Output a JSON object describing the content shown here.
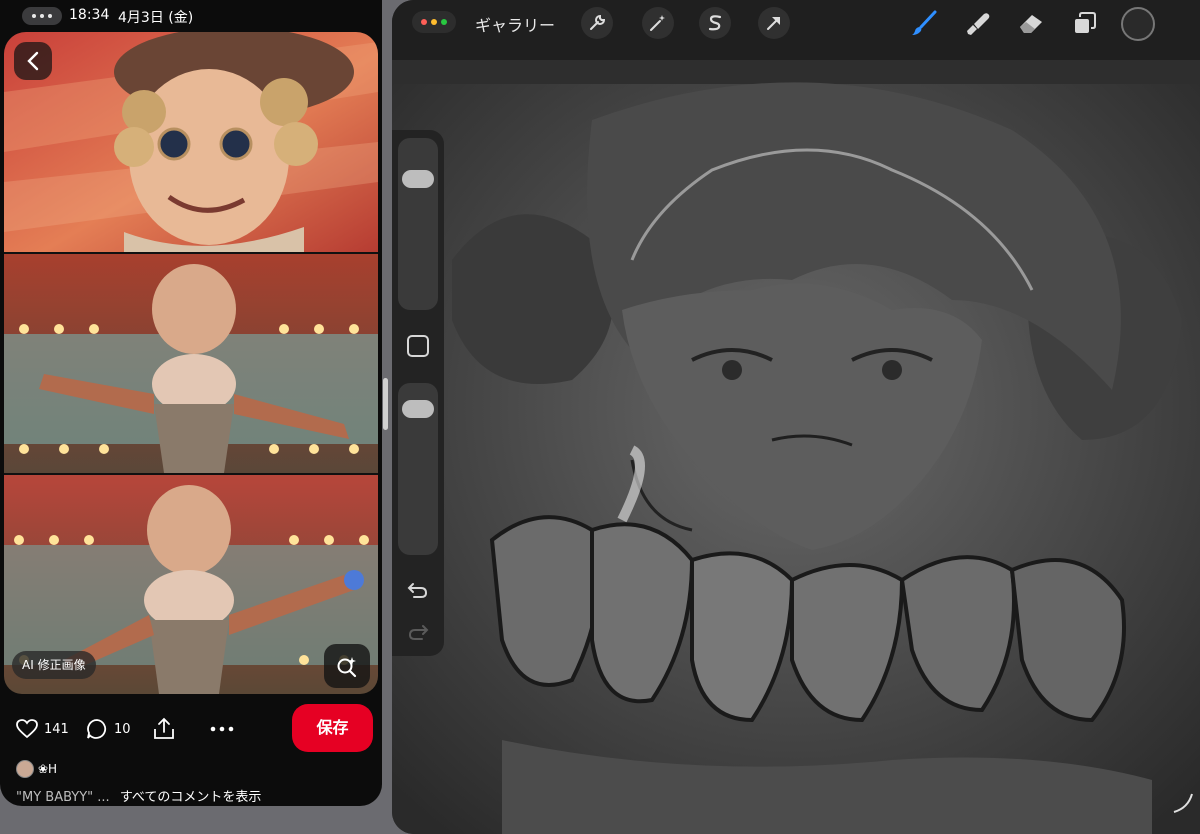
{
  "status": {
    "time": "18:34",
    "date": "4月3日 (金)"
  },
  "left": {
    "ai_badge": "AI 修正画像",
    "likes": "141",
    "comments": "10",
    "save_label": "保存",
    "author": "❀H",
    "caption_quote": "\"MY BABYY\" ...",
    "caption_comments": "すべてのコメントを表示"
  },
  "right": {
    "gallery_label": "ギャラリー",
    "tools_left": [
      "wrench-icon",
      "magic-wand-icon",
      "selection-icon",
      "transform-arrow-icon"
    ],
    "tools_right": [
      "brush-icon",
      "smudge-icon",
      "eraser-icon",
      "layers-icon"
    ],
    "active_tool": "brush-icon",
    "accent_color": "#2f8fff",
    "brush_size_level": 0.18,
    "opacity_level": 0.08
  },
  "colors": {
    "save": "#e60023",
    "panel_bg": "#0c0c0c",
    "procreate_bg": "#1f1f1f"
  }
}
